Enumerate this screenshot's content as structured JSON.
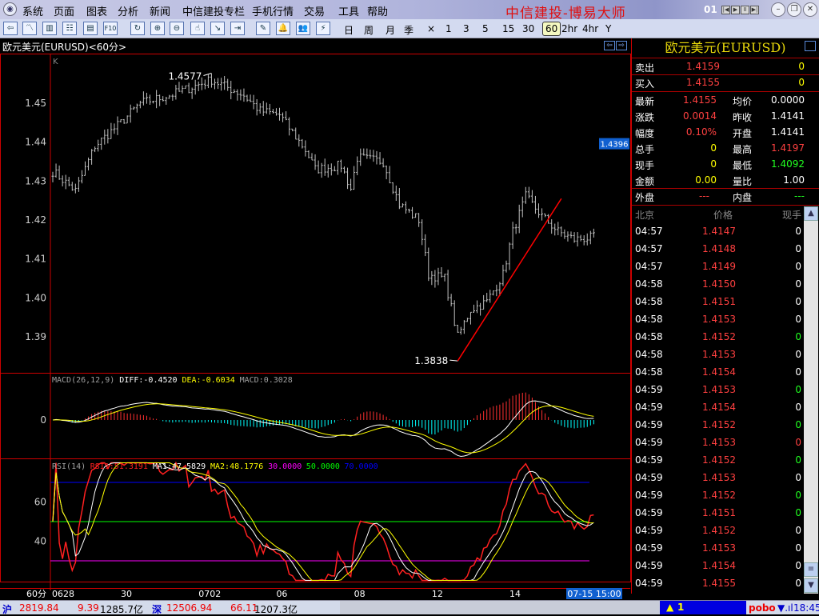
{
  "title_bar": {
    "app_icon": "app-logo-icon",
    "menu": [
      "系统",
      "页面",
      "图表",
      "分析",
      "新闻",
      "中信建投专栏",
      "手机行情",
      "交易",
      "工具",
      "帮助"
    ],
    "brand": "中信建投-博易大师",
    "page_num": "01",
    "window_buttons": [
      "minimize",
      "restore",
      "close"
    ]
  },
  "toolbar": {
    "icons": [
      "back-icon",
      "line-chart-icon",
      "candle-chart-icon",
      "quote-list-icon",
      "news-icon",
      "f10-icon",
      "refresh-icon",
      "zoom-in-icon",
      "zoom-out-icon",
      "pointer-icon",
      "export-icon",
      "indicator-icon",
      "draw-icon",
      "alert-bell-icon",
      "users-icon",
      "flash-icon"
    ],
    "f10_label": "F10",
    "periods": [
      "日",
      "周",
      "月",
      "季",
      "×",
      "1",
      "3",
      "5",
      "15",
      "30",
      "60",
      "2hr",
      "4hr",
      "Y"
    ],
    "selected_period": "60"
  },
  "chart": {
    "title": "欧元美元(EURUSD)<60分>",
    "k_label": "K",
    "period_label": "60分",
    "current_price_tag": "1.4396",
    "high_label": "1.4577",
    "low_label": "1.3838",
    "cursor_time": "07-15 15:00"
  },
  "chart_data": [
    {
      "type": "candlestick",
      "title": "欧元美元(EURUSD)<60分>",
      "ylim": [
        1.381,
        1.461
      ],
      "yticks": [
        "1.45",
        "1.44",
        "1.43",
        "1.42",
        "1.41",
        "1.40",
        "1.39"
      ],
      "ytick_values": [
        1.45,
        1.44,
        1.43,
        1.42,
        1.41,
        1.4,
        1.39
      ],
      "xticks": [
        "0628",
        "30",
        "0702",
        "06",
        "08",
        "12",
        "14"
      ],
      "xtick_bars": [
        0,
        21,
        45,
        69,
        93,
        117,
        141
      ],
      "bar_count": 168,
      "price_path": [
        [
          0,
          1.4325
        ],
        [
          7,
          1.4275
        ],
        [
          13,
          1.439
        ],
        [
          21,
          1.445
        ],
        [
          27,
          1.45
        ],
        [
          36,
          1.452
        ],
        [
          49,
          1.456
        ],
        [
          59,
          1.452
        ],
        [
          64,
          1.448
        ],
        [
          70,
          1.447
        ],
        [
          78,
          1.438
        ],
        [
          81,
          1.433
        ],
        [
          89,
          1.434
        ],
        [
          92,
          1.428
        ],
        [
          94,
          1.436
        ],
        [
          102,
          1.435
        ],
        [
          107,
          1.424
        ],
        [
          113,
          1.42
        ],
        [
          116,
          1.406
        ],
        [
          121,
          1.405
        ],
        [
          125,
          1.39
        ],
        [
          129,
          1.397
        ],
        [
          134,
          1.399
        ],
        [
          139,
          1.406
        ],
        [
          142,
          1.417
        ],
        [
          146,
          1.426
        ],
        [
          151,
          1.421
        ],
        [
          156,
          1.417
        ],
        [
          161,
          1.415
        ],
        [
          167,
          1.4155
        ]
      ],
      "high": 1.4577,
      "low": 1.3838,
      "last": 1.4396,
      "trendline": [
        [
          125,
          1.3838
        ],
        [
          157,
          1.4255
        ]
      ]
    },
    {
      "type": "line",
      "title": "MACD(26,12,9)",
      "legend": [
        {
          "name": "MACD(26,12,9)",
          "color": "#a0a0a0"
        },
        {
          "name": "DIFF:-0.4520",
          "color": "#ffffff"
        },
        {
          "name": "DEA:-0.6034",
          "color": "#ffff00"
        },
        {
          "name": "MACD:0.3028",
          "color": "#a0a0a0"
        }
      ],
      "yticks": [
        "0"
      ]
    },
    {
      "type": "line",
      "title": "RSI(14)",
      "legend": [
        {
          "name": "RSI(14)",
          "color": "#a0a0a0"
        },
        {
          "name": "RSI1:51.3191",
          "color": "#ff2020"
        },
        {
          "name": "MA1:47.5829",
          "color": "#ffffff"
        },
        {
          "name": "MA2:48.1776",
          "color": "#ffff00"
        },
        {
          "name": "30.0000",
          "color": "#ff00ff"
        },
        {
          "name": "50.0000",
          "color": "#00ff00"
        },
        {
          "name": "70.0000",
          "color": "#0000ff"
        }
      ],
      "yticks": [
        "60",
        "40"
      ],
      "ytick_values": [
        60,
        40
      ],
      "ylim": [
        18,
        82
      ],
      "levels": [
        {
          "value": 70,
          "color": "#0000ff"
        },
        {
          "value": 50,
          "color": "#00ff00"
        },
        {
          "value": 30,
          "color": "#ff00ff"
        }
      ]
    }
  ],
  "quote_panel": {
    "title": "欧元美元(EURUSD)",
    "sell": {
      "label": "卖出",
      "price": "1.4159",
      "vol": "0"
    },
    "buy": {
      "label": "买入",
      "price": "1.4155",
      "vol": "0"
    },
    "stats": [
      {
        "l1": "最新",
        "v1": "1.4155",
        "c1": "#ff4040",
        "l2": "均价",
        "v2": "0.0000",
        "c2": "#ffffff"
      },
      {
        "l1": "涨跌",
        "v1": "0.0014",
        "c1": "#ff4040",
        "l2": "昨收",
        "v2": "1.4141",
        "c2": "#ffffff"
      },
      {
        "l1": "幅度",
        "v1": "0.10%",
        "c1": "#ff4040",
        "l2": "开盘",
        "v2": "1.4141",
        "c2": "#ffffff"
      },
      {
        "l1": "总手",
        "v1": "0",
        "c1": "#ffff00",
        "l2": "最高",
        "v2": "1.4197",
        "c2": "#ff4040"
      },
      {
        "l1": "现手",
        "v1": "0",
        "c1": "#ffff00",
        "l2": "最低",
        "v2": "1.4092",
        "c2": "#20ff20"
      },
      {
        "l1": "金额",
        "v1": "0.00",
        "c1": "#ffff00",
        "l2": "量比",
        "v2": "1.00",
        "c2": "#ffffff"
      }
    ],
    "outer": {
      "label": "外盘",
      "value": "---"
    },
    "inner": {
      "label": "内盘",
      "value": "---"
    },
    "ticks_header": [
      "北京",
      "价格",
      "现手"
    ],
    "ticks": [
      {
        "time": "04:57",
        "price": "1.4147",
        "vol": "0",
        "vc": "#ffffff"
      },
      {
        "time": "04:57",
        "price": "1.4148",
        "vol": "0",
        "vc": "#ffffff"
      },
      {
        "time": "04:57",
        "price": "1.4149",
        "vol": "0",
        "vc": "#ffffff"
      },
      {
        "time": "04:58",
        "price": "1.4150",
        "vol": "0",
        "vc": "#ffffff"
      },
      {
        "time": "04:58",
        "price": "1.4151",
        "vol": "0",
        "vc": "#ffffff"
      },
      {
        "time": "04:58",
        "price": "1.4153",
        "vol": "0",
        "vc": "#ffffff"
      },
      {
        "time": "04:58",
        "price": "1.4152",
        "vol": "0",
        "vc": "#20ff20"
      },
      {
        "time": "04:58",
        "price": "1.4153",
        "vol": "0",
        "vc": "#ffffff"
      },
      {
        "time": "04:58",
        "price": "1.4154",
        "vol": "0",
        "vc": "#ffffff"
      },
      {
        "time": "04:59",
        "price": "1.4153",
        "vol": "0",
        "vc": "#20ff20"
      },
      {
        "time": "04:59",
        "price": "1.4154",
        "vol": "0",
        "vc": "#ffffff"
      },
      {
        "time": "04:59",
        "price": "1.4152",
        "vol": "0",
        "vc": "#20ff20"
      },
      {
        "time": "04:59",
        "price": "1.4153",
        "vol": "0",
        "vc": "#ff4040"
      },
      {
        "time": "04:59",
        "price": "1.4152",
        "vol": "0",
        "vc": "#20ff20"
      },
      {
        "time": "04:59",
        "price": "1.4153",
        "vol": "0",
        "vc": "#ffffff"
      },
      {
        "time": "04:59",
        "price": "1.4152",
        "vol": "0",
        "vc": "#20ff20"
      },
      {
        "time": "04:59",
        "price": "1.4151",
        "vol": "0",
        "vc": "#20ff20"
      },
      {
        "time": "04:59",
        "price": "1.4152",
        "vol": "0",
        "vc": "#ffffff"
      },
      {
        "time": "04:59",
        "price": "1.4153",
        "vol": "0",
        "vc": "#ffffff"
      },
      {
        "time": "04:59",
        "price": "1.4154",
        "vol": "0",
        "vc": "#ffffff"
      },
      {
        "time": "04:59",
        "price": "1.4155",
        "vol": "0",
        "vc": "#ffffff"
      }
    ]
  },
  "status_bar": {
    "sh_label": "沪",
    "sh_index": "2819.84",
    "sh_change": "9.39",
    "sh_amount": "1285.7亿",
    "sz_label": "深",
    "sz_index": "12506.94",
    "sz_change": "66.11",
    "sz_amount": "1207.3亿",
    "alert": "1",
    "brand": "pobo",
    "time": "18:45"
  },
  "colors": {
    "up": "#ff3030",
    "down": "#00ffff",
    "bar": "#c0c0c0",
    "frame": "#cc0000",
    "trend": "#ff0000"
  }
}
